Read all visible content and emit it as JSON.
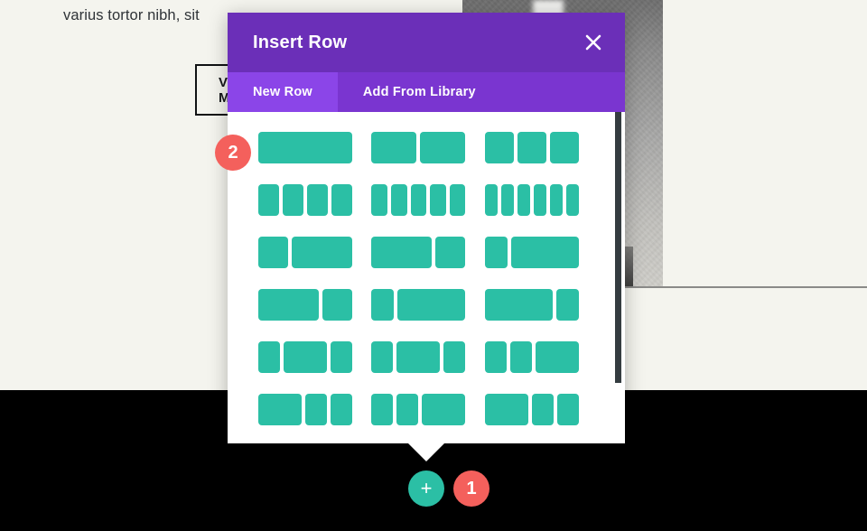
{
  "background": {
    "paragraph_text": "varius tortor nibh, sit",
    "button_label": "VIEW MORE",
    "photo_alt": "glass-cloche-on-pedestal-photo"
  },
  "modal": {
    "title": "Insert Row",
    "close_icon": "close-icon",
    "tabs": [
      {
        "label": "New Row",
        "active": true
      },
      {
        "label": "Add From Library",
        "active": false
      }
    ],
    "layouts": [
      {
        "name": "full-width",
        "columns": [
          12
        ]
      },
      {
        "name": "one-half-one-half",
        "columns": [
          6,
          6
        ]
      },
      {
        "name": "one-third-one-third-one-third",
        "columns": [
          4,
          4,
          4
        ]
      },
      {
        "name": "one-fourth-x4",
        "columns": [
          3,
          3,
          3,
          3
        ]
      },
      {
        "name": "one-fifth-x5",
        "columns": [
          2.4,
          2.4,
          2.4,
          2.4,
          2.4
        ]
      },
      {
        "name": "one-sixth-x6",
        "columns": [
          2,
          2,
          2,
          2,
          2,
          2
        ]
      },
      {
        "name": "one-third-two-thirds",
        "columns": [
          4,
          8
        ]
      },
      {
        "name": "two-thirds-one-third",
        "columns": [
          8,
          4
        ]
      },
      {
        "name": "one-fourth-three-fourths",
        "columns": [
          3,
          9
        ]
      },
      {
        "name": "two-thirds-one-third-b",
        "columns": [
          8,
          4
        ]
      },
      {
        "name": "one-fourth-three-fourths-b",
        "columns": [
          3,
          9
        ]
      },
      {
        "name": "three-fourths-one-fourth",
        "columns": [
          9,
          3
        ]
      },
      {
        "name": "one-fourth-one-half-one-fourth",
        "columns": [
          3,
          6,
          3
        ]
      },
      {
        "name": "one-fourth-one-half-one-fourth-b",
        "columns": [
          3,
          6,
          3
        ]
      },
      {
        "name": "one-fourth-one-fourth-one-half",
        "columns": [
          3,
          3,
          6
        ]
      },
      {
        "name": "one-half-one-fourth-one-fourth",
        "columns": [
          6,
          3,
          3
        ]
      },
      {
        "name": "one-fourth-one-fourth-one-half-b",
        "columns": [
          3,
          3,
          6
        ]
      },
      {
        "name": "one-half-one-fourth-one-fourth-b",
        "columns": [
          6,
          3,
          3
        ]
      }
    ],
    "scrollbar": "vertical-scrollbar"
  },
  "overlay": {
    "add_button_glyph": "+",
    "step_badges": [
      {
        "label": "1"
      },
      {
        "label": "2"
      }
    ]
  },
  "colors": {
    "modal_header_purple": "#6b2fb8",
    "tab_bar_purple": "#7a35d0",
    "tab_active_purple": "#8b45e8",
    "layout_block_teal": "#2bbfa5",
    "badge_red": "#f4605c",
    "page_background": "#f4f4ee",
    "dark_band": "#000000",
    "scrollbar_thumb": "#343c40"
  }
}
